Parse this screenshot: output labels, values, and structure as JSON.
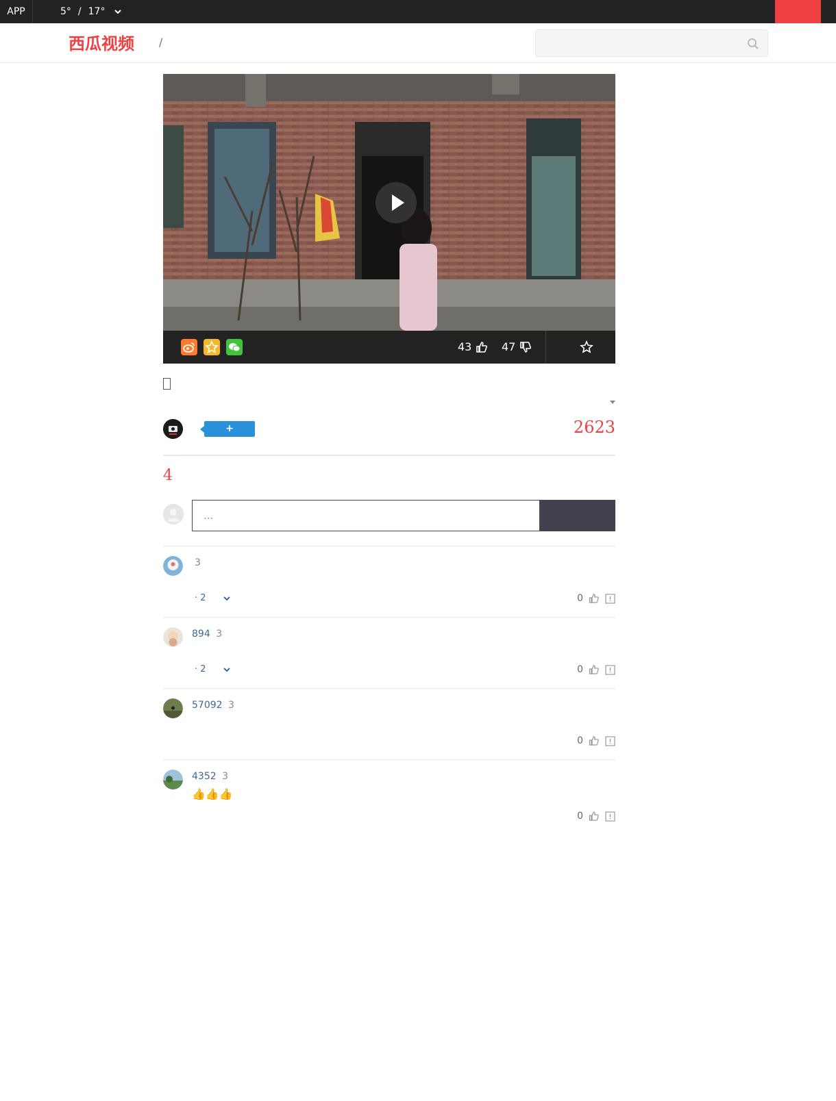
{
  "topbar": {
    "app_label": "APP",
    "temp_low": "5°",
    "temp_sep": "/",
    "temp_high": "17°"
  },
  "header": {
    "brand": "西瓜视频",
    "breadcrumb_sep": "/",
    "search_placeholder": ""
  },
  "player": {
    "likes": "43",
    "dislikes": "47",
    "share_icons": [
      "weibo-icon",
      "qzone-icon",
      "wechat-icon"
    ]
  },
  "info": {
    "follow_label": "+",
    "view_count": "2623"
  },
  "comments_section": {
    "count": "4",
    "input_placeholder": "...",
    "items": [
      {
        "user": "",
        "time": "3",
        "reply_text": "· 2",
        "likes": "0",
        "body": ""
      },
      {
        "user": "894",
        "time": "3",
        "reply_text": "· 2",
        "likes": "0",
        "body": ""
      },
      {
        "user": "57092",
        "time": "3",
        "reply_text": "",
        "likes": "0",
        "body": ""
      },
      {
        "user": "4352",
        "time": "3",
        "reply_text": "",
        "likes": "0",
        "body": "👍👍👍"
      }
    ]
  },
  "colors": {
    "brand_red": "#f04142",
    "follow_blue": "#2a90d9",
    "link_blue": "#406599",
    "dark": "#222222"
  }
}
